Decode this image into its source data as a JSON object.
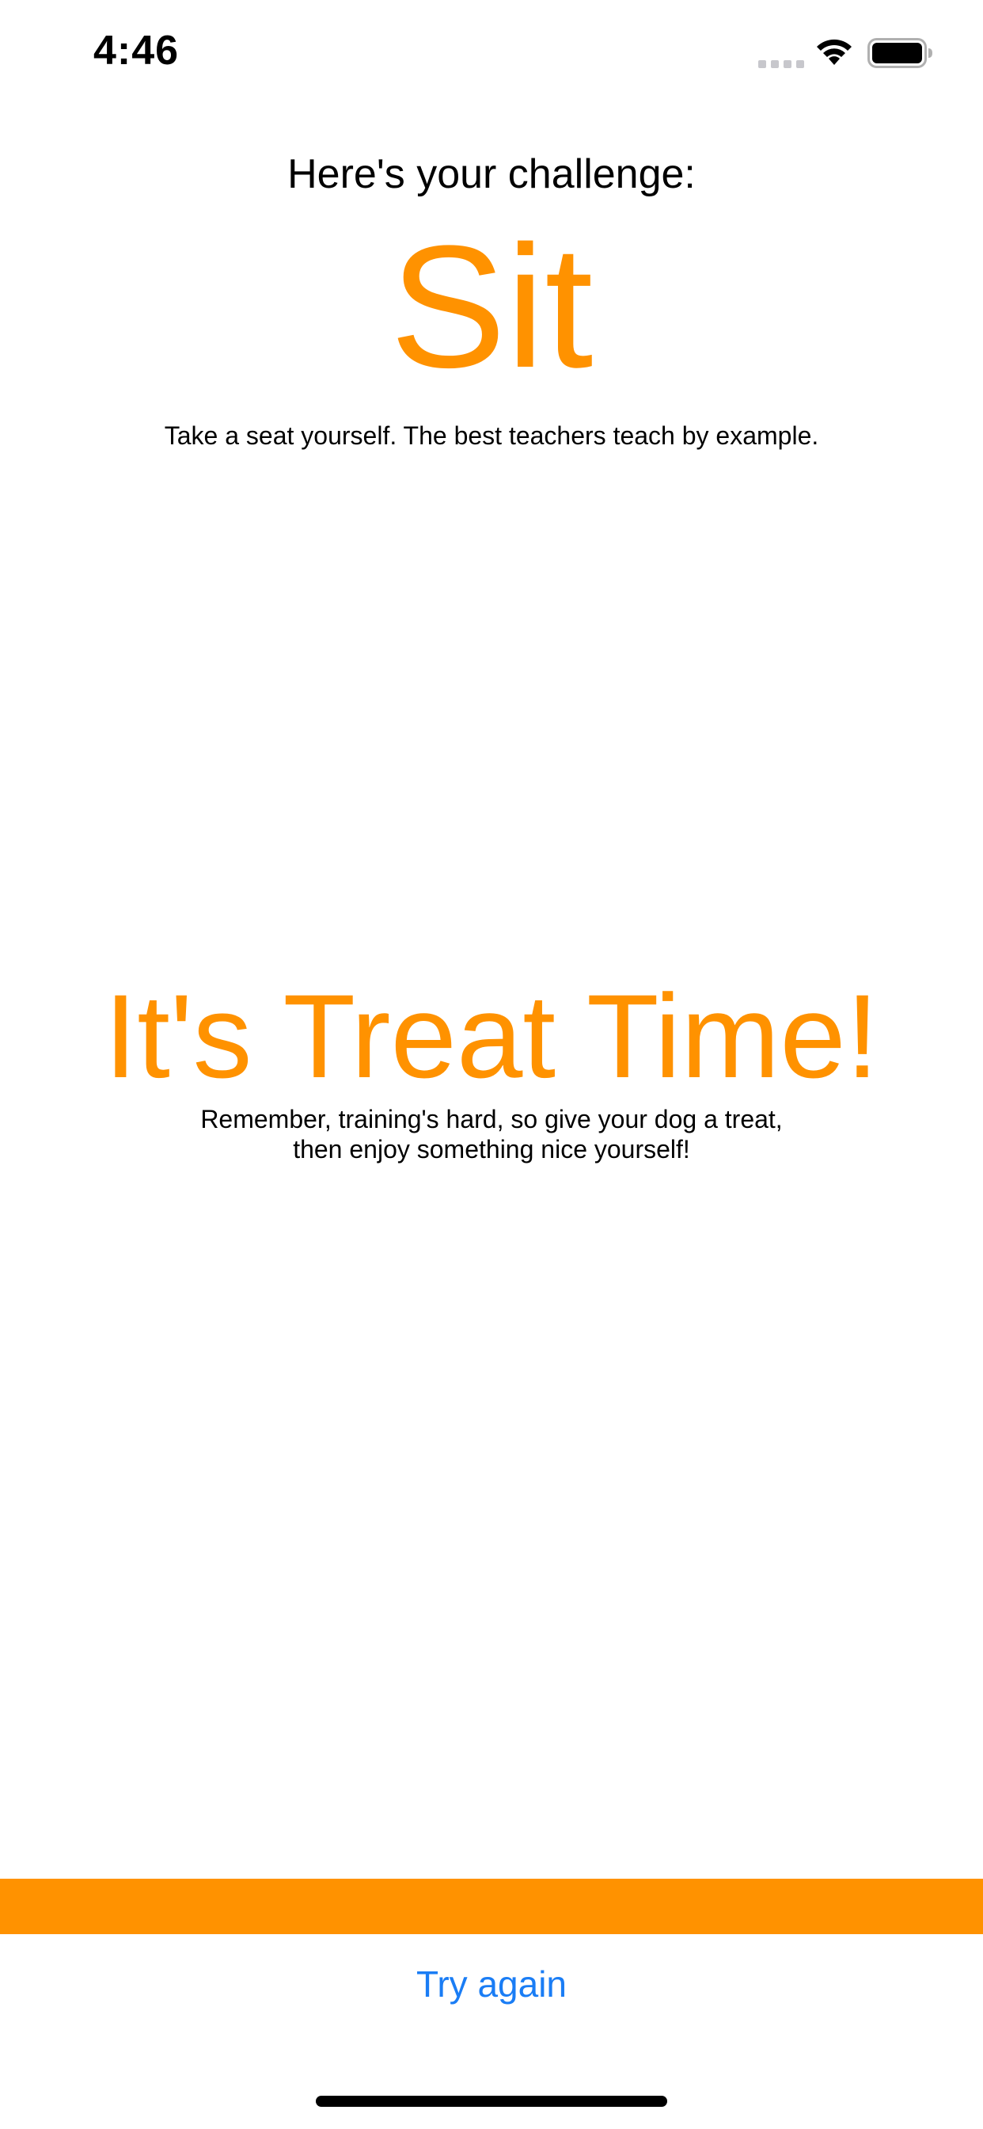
{
  "status_bar": {
    "time": "4:46",
    "icons": [
      "cellular-signal-icon",
      "wifi-icon",
      "battery-icon"
    ]
  },
  "challenge": {
    "heading": "Here's your challenge:",
    "command": "Sit",
    "description": "Take a seat yourself. The best teachers teach by example."
  },
  "treat": {
    "title": "It's Treat Time!",
    "message_lines": [
      "Remember, training's hard, so give your dog a treat,",
      "then enjoy something nice yourself!"
    ]
  },
  "actions": {
    "try_again_label": "Try again"
  },
  "colors": {
    "accent": "#ff9200",
    "link": "#1a7df5",
    "text": "#000000",
    "background": "#ffffff"
  }
}
